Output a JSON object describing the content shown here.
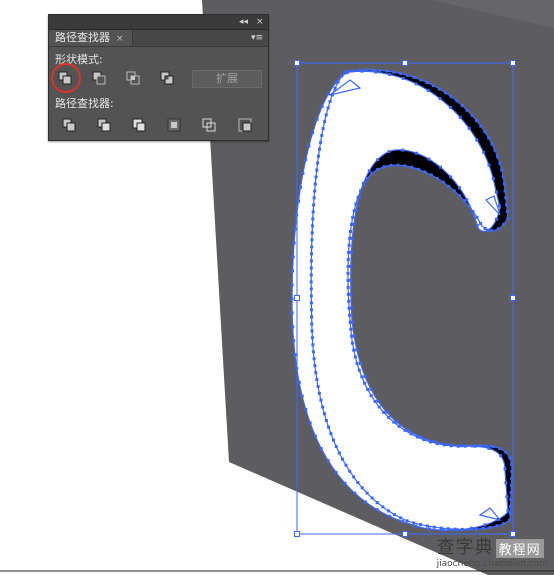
{
  "panel": {
    "collapse_glyph": "◂◂",
    "close_glyph": "×",
    "tab_label": "路径查找器",
    "tab_close_glyph": "×",
    "menu_glyph": "▾≡",
    "shape_modes_label": "形状模式:",
    "pathfinders_label": "路径查找器:",
    "expand_label": "扩展",
    "shape_mode_icons": [
      "unite-icon",
      "minus-front-icon",
      "intersect-icon",
      "exclude-icon"
    ],
    "pathfinder_icons": [
      "divide-icon",
      "trim-icon",
      "merge-icon",
      "crop-icon",
      "outline-icon",
      "minus-back-icon"
    ]
  },
  "watermark": {
    "title": "查字典",
    "badge": "教程网",
    "url": "jiaocheng.chazidian.com"
  },
  "colors": {
    "panel_bg": "#535353",
    "canvas_dark": "#5d5d60",
    "selection_blue": "#3d67ff",
    "highlight_red": "#e0302a"
  }
}
